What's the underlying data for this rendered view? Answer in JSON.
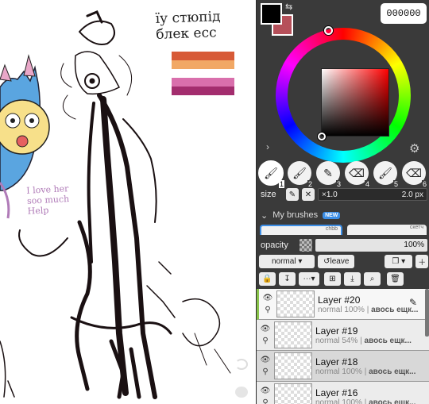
{
  "canvas": {
    "handwriting_title": "їу стюпід блек есс",
    "handwriting_love": "I love her soo much Help",
    "flag_colors": [
      "#d75a37",
      "#f1a865",
      "#ffffff",
      "#d96fac",
      "#a32d6e"
    ]
  },
  "colors": {
    "foreground": "#000000",
    "background_swatch": "#b6505a",
    "hex_value": "000000"
  },
  "icons": {
    "swap": "⇆",
    "expand": "›",
    "gear": "⚙"
  },
  "brushes": {
    "slots": [
      {
        "num": "1",
        "glyph": "🖌",
        "icon": "brush-icon",
        "active": true
      },
      {
        "num": "2",
        "glyph": "🖌",
        "icon": "brush-icon"
      },
      {
        "num": "3",
        "glyph": "✎",
        "icon": "pen-icon"
      },
      {
        "num": "4",
        "glyph": "⌫",
        "icon": "eraser-icon"
      },
      {
        "num": "5",
        "glyph": "🖌",
        "icon": "brush-icon"
      },
      {
        "num": "6",
        "glyph": "⌫",
        "icon": "eraser-icon"
      }
    ],
    "size_label": "size",
    "size_scale": "×1.0",
    "size_value": "2.0 px",
    "my_brushes_label": "My brushes",
    "new_badge": "NEW",
    "preview_1": "chbb",
    "preview_2": "скетч"
  },
  "opacity": {
    "label": "opacity",
    "value": "100%"
  },
  "blend": {
    "mode": "normal ▾",
    "leave": "↺leave"
  },
  "layers": [
    {
      "name": "Layer #20",
      "mode": "normal 100%",
      "extra": "авось ещк...",
      "selected": true
    },
    {
      "name": "Layer #19",
      "mode": "normal 54%",
      "extra": "авось ещк..."
    },
    {
      "name": "Layer #18",
      "mode": "normal 100%",
      "extra": "авось ещк..."
    },
    {
      "name": "Layer #16",
      "mode": "normal 100%",
      "extra": "авось ещк..."
    }
  ]
}
